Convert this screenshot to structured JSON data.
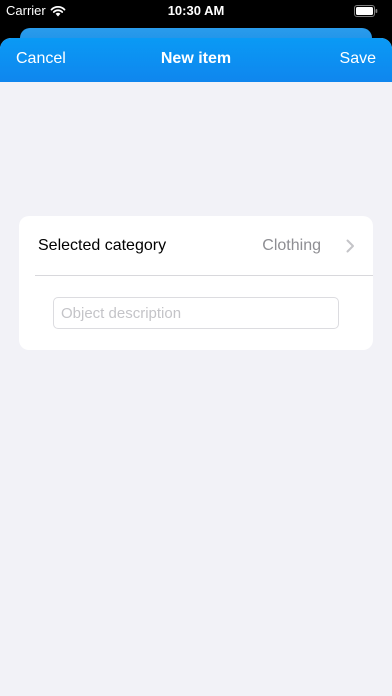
{
  "status_bar": {
    "carrier": "Carrier",
    "time": "10:30 AM"
  },
  "nav": {
    "cancel_label": "Cancel",
    "title": "New item",
    "save_label": "Save"
  },
  "form": {
    "category_label": "Selected category",
    "category_value": "Clothing",
    "description_placeholder": "Object description",
    "description_value": ""
  },
  "icons": {
    "wifi": "wifi-icon",
    "battery": "battery-icon",
    "chevron": "chevron-right-icon"
  },
  "colors": {
    "nav_blue": "#0f86ee",
    "background": "#f2f2f7",
    "secondary_text": "#8e8e93"
  }
}
